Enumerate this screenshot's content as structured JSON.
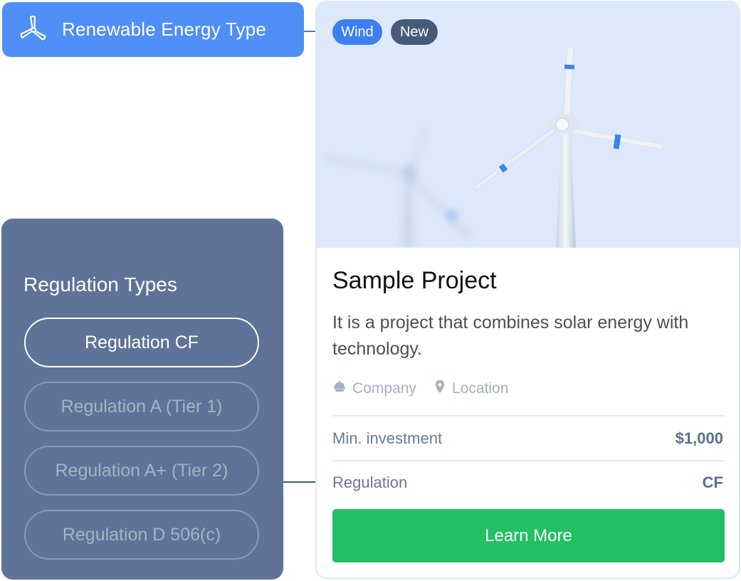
{
  "energy_type": {
    "label": "Renewable Energy Type",
    "icon": "wind-turbine-icon",
    "color": "#4f8ff7"
  },
  "regulation_panel": {
    "title": "Regulation Types",
    "options": [
      {
        "label": "Regulation CF",
        "selected": true
      },
      {
        "label": "Regulation A (Tier 1)",
        "selected": false
      },
      {
        "label": "Regulation A+ (Tier 2)",
        "selected": false
      },
      {
        "label": "Regulation D 506(c)",
        "selected": false
      }
    ],
    "color": "#5e7397"
  },
  "card": {
    "badges": [
      {
        "label": "Wind",
        "color": "#3b7ff0"
      },
      {
        "label": "New",
        "color": "#475a77"
      }
    ],
    "title": "Sample Project",
    "description": "It is a project that combines solar energy with technology.",
    "company": {
      "icon": "building-icon",
      "label": "Company"
    },
    "location": {
      "icon": "map-pin-icon",
      "label": "Location"
    },
    "rows": [
      {
        "label": "Min. investment",
        "value": "$1,000"
      },
      {
        "label": "Regulation",
        "value": "CF"
      }
    ],
    "cta": {
      "label": "Learn More",
      "color": "#22c063"
    }
  }
}
